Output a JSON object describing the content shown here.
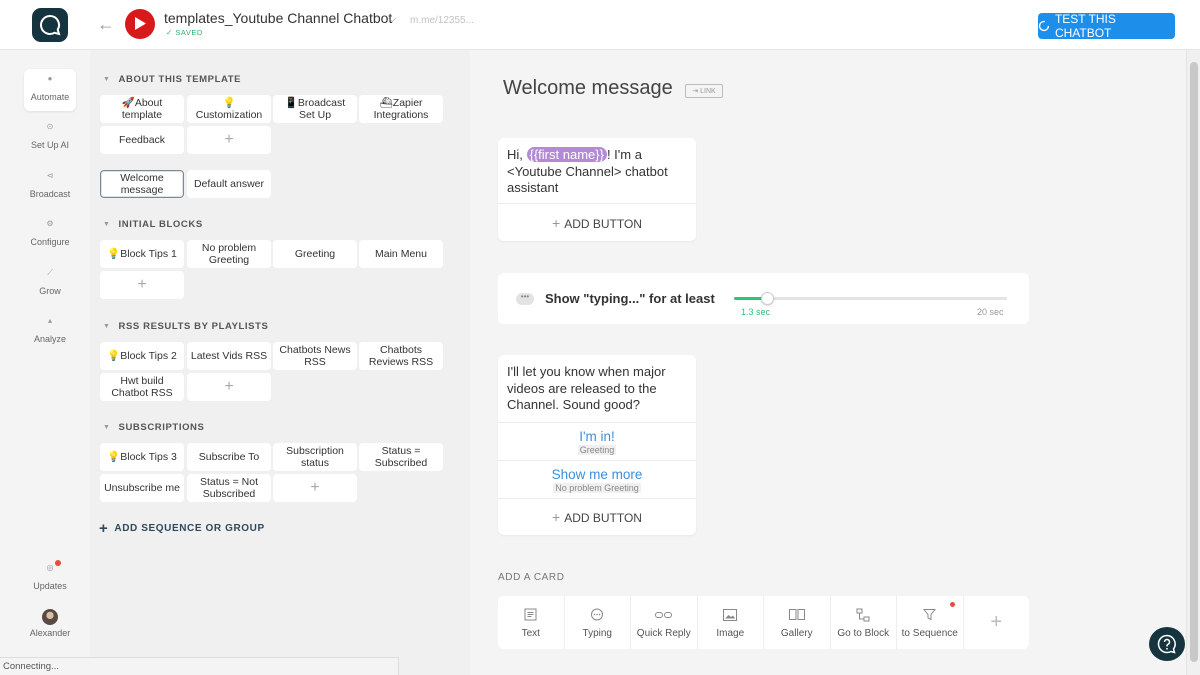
{
  "header": {
    "bot_title": "templates_Youtube Channel Chatbot",
    "saved": "SAVED",
    "short_link": "m.me/12355...",
    "test_button": "TEST THIS CHATBOT"
  },
  "sidebar": {
    "items": [
      {
        "label": "Automate",
        "icon": "automate-icon"
      },
      {
        "label": "Set Up AI",
        "icon": "ai-icon"
      },
      {
        "label": "Broadcast",
        "icon": "broadcast-icon"
      },
      {
        "label": "Configure",
        "icon": "configure-icon"
      },
      {
        "label": "Grow",
        "icon": "grow-icon"
      },
      {
        "label": "Analyze",
        "icon": "analyze-icon"
      }
    ],
    "updates": "Updates",
    "user": "Alexander"
  },
  "left": {
    "sections": {
      "about": "ABOUT THIS TEMPLATE",
      "initial": "INITIAL BLOCKS",
      "rss": "RSS RESULTS BY PLAYLISTS",
      "subscriptions": "SUBSCRIPTIONS"
    },
    "about_blocks": [
      "About template",
      "Customization",
      "Broadcast Set Up",
      "Zapier Integrations",
      "Feedback"
    ],
    "welcome_blocks": [
      "Welcome message",
      "Default answer"
    ],
    "initial_blocks": [
      "Block Tips 1",
      "No problem Greeting",
      "Greeting",
      "Main Menu"
    ],
    "rss_blocks": [
      "Block Tips 2",
      "Latest Vids RSS",
      "Chatbots News RSS",
      "Chatbots Reviews RSS",
      "Hwt build Chatbot RSS"
    ],
    "subscription_blocks": [
      "Block Tips 3",
      "Subscribe To",
      "Subscription status",
      "Status = Subscribed",
      "Unsubscribe me",
      "Status = Not Subscribed"
    ],
    "plus": "+",
    "add_sequence": "ADD SEQUENCE OR GROUP"
  },
  "status_bar": "Connecting...",
  "editor": {
    "title": "Welcome message",
    "link_badge": "LINK",
    "card1": {
      "prefix": "Hi, ",
      "variable": "{{first name}}",
      "suffix": "! I'm a <Youtube Channel> chatbot assistant",
      "add_button": "ADD BUTTON"
    },
    "typing": {
      "label": "Show \"typing...\" for at least",
      "min": "1.3 sec",
      "max": "20 sec",
      "value_seconds": 1.3,
      "range": [
        0,
        20
      ]
    },
    "card2": {
      "text": "I'll let you know when major videos are released to the Channel. Sound good?",
      "replies": [
        {
          "label": "I'm in!",
          "target": "Greeting"
        },
        {
          "label": "Show me more",
          "target": "No problem Greeting"
        }
      ],
      "add_button": "ADD BUTTON"
    },
    "add_card_label": "ADD A CARD",
    "tools": [
      "Text",
      "Typing",
      "Quick Reply",
      "Image",
      "Gallery",
      "Go to Block",
      "to Sequence"
    ]
  },
  "colors": {
    "accent": "#1d8eea",
    "brand_dark": "#15343f",
    "youtube_red": "#d7191c",
    "saved_green": "#2db26e",
    "variable_purple": "#b28ad6",
    "reply_blue": "#3b8fde"
  }
}
